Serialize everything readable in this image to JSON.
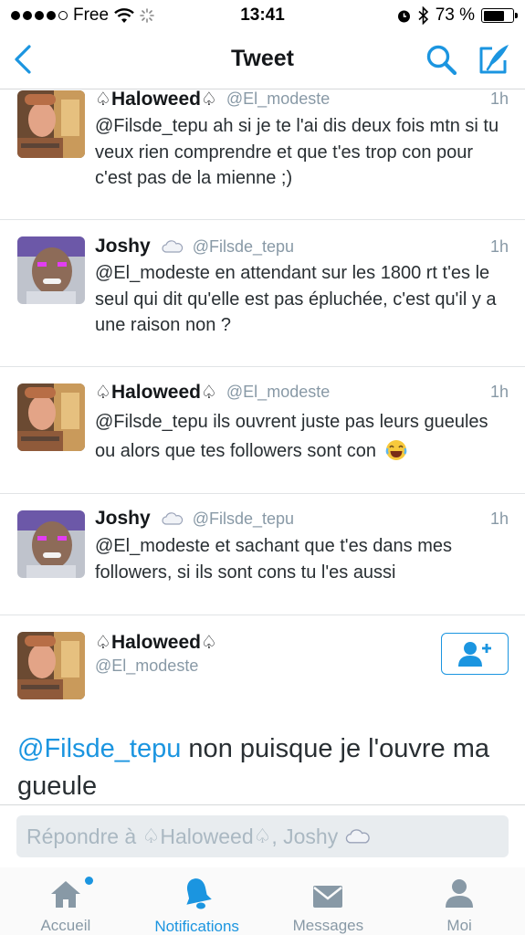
{
  "status_bar": {
    "carrier": "Free",
    "time": "13:41",
    "battery_percent": "73 %",
    "battery_level": 0.73
  },
  "nav": {
    "title": "Tweet"
  },
  "tweets": [
    {
      "name": "Haloweed",
      "handle": "@El_modeste",
      "time": "1h",
      "text": "@Filsde_tepu ah si je te l'ai dis deux fois mtn si tu veux rien comprendre et que t'es trop con pour c'est pas de la mienne ;)"
    },
    {
      "name": "Joshy",
      "handle": "@Filsde_tepu",
      "time": "1h",
      "text": "@El_modeste en attendant sur les 1800 rt t'es le seul qui dit qu'elle est pas épluchée, c'est qu'il y a une raison non ?"
    },
    {
      "name": "Haloweed",
      "handle": "@El_modeste",
      "time": "1h",
      "text": "@Filsde_tepu ils ouvrent juste pas leurs gueules ou alors que tes followers sont con"
    },
    {
      "name": "Joshy",
      "handle": "@Filsde_tepu",
      "time": "1h",
      "text": "@El_modeste et sachant que t'es dans mes followers, si ils sont cons tu l'es aussi"
    }
  ],
  "main_tweet": {
    "name": "Haloweed",
    "handle": "@El_modeste",
    "mention": "@Filsde_tepu",
    "text": " non puisque je l'ouvre ma gueule"
  },
  "reply": {
    "placeholder_prefix": "Répondre à ",
    "placeholder_name1": "Haloweed",
    "placeholder_sep": ", Joshy"
  },
  "tabs": [
    {
      "label": "Accueil",
      "icon": "home-icon"
    },
    {
      "label": "Notifications",
      "icon": "bell-icon"
    },
    {
      "label": "Messages",
      "icon": "envelope-icon"
    },
    {
      "label": "Moi",
      "icon": "person-icon"
    }
  ],
  "colors": {
    "accent": "#1b95e0",
    "secondary_text": "#8899a6"
  }
}
